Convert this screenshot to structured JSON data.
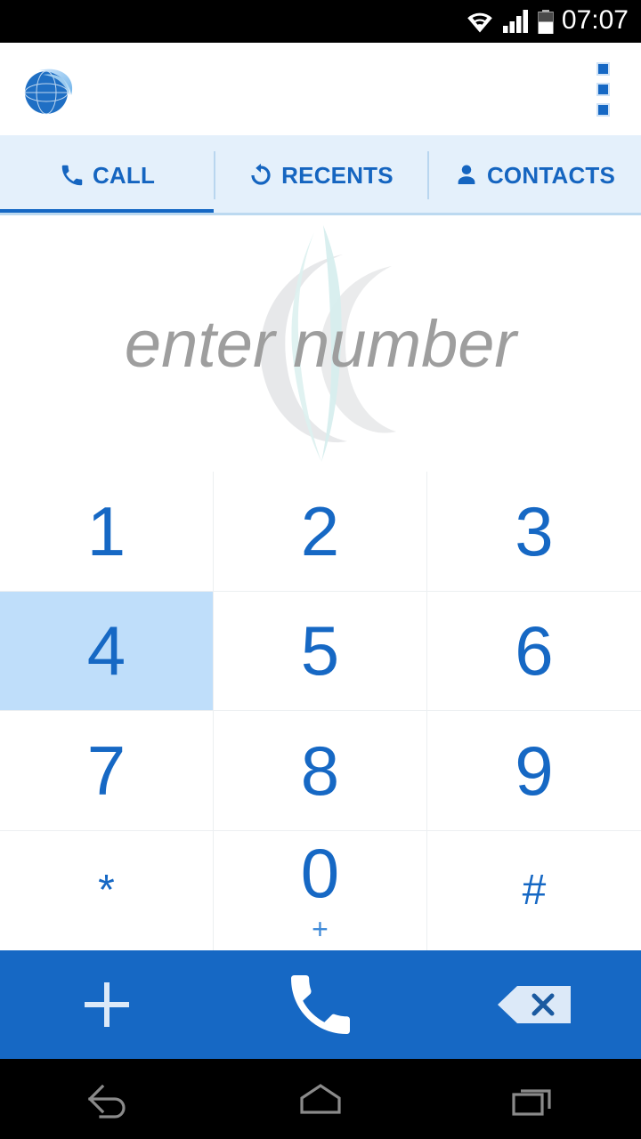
{
  "status_bar": {
    "time": "07:07",
    "icons": [
      "wifi-icon",
      "cellular-signal-icon",
      "battery-icon"
    ],
    "background_color": "#000000",
    "text_color": "#ffffff"
  },
  "app_bar": {
    "logo_name": "app-logo-globe",
    "overflow_menu_label": "",
    "background_color": "#ffffff"
  },
  "tabs": {
    "active_index": 0,
    "accent_color": "#1668c4",
    "background_color": "#e4f0fb",
    "items": [
      {
        "label": "CALL",
        "icon": "phone-icon",
        "active": true
      },
      {
        "label": "RECENTS",
        "icon": "history-icon",
        "active": false
      },
      {
        "label": "CONTACTS",
        "icon": "person-icon",
        "active": false
      }
    ]
  },
  "display": {
    "entry_value": "",
    "placeholder": "enter number",
    "placeholder_color": "#9e9e9e",
    "watermark_name": "crescent-watermark"
  },
  "keypad": {
    "pressed_key": "4",
    "digit_color": "#1668c4",
    "pressed_background": "#bfdefa",
    "keys": [
      {
        "digit": "1",
        "sub": "",
        "pressed": false,
        "small": false
      },
      {
        "digit": "2",
        "sub": "",
        "pressed": false,
        "small": false
      },
      {
        "digit": "3",
        "sub": "",
        "pressed": false,
        "small": false
      },
      {
        "digit": "4",
        "sub": "",
        "pressed": true,
        "small": false
      },
      {
        "digit": "5",
        "sub": "",
        "pressed": false,
        "small": false
      },
      {
        "digit": "6",
        "sub": "",
        "pressed": false,
        "small": false
      },
      {
        "digit": "7",
        "sub": "",
        "pressed": false,
        "small": false
      },
      {
        "digit": "8",
        "sub": "",
        "pressed": false,
        "small": false
      },
      {
        "digit": "9",
        "sub": "",
        "pressed": false,
        "small": false
      },
      {
        "digit": "*",
        "sub": "",
        "pressed": false,
        "small": true
      },
      {
        "digit": "0",
        "sub": "+",
        "pressed": false,
        "small": false
      },
      {
        "digit": "#",
        "sub": "",
        "pressed": false,
        "small": true
      }
    ]
  },
  "action_bar": {
    "background_color": "#1668c4",
    "buttons": [
      {
        "name": "add-contact-button",
        "icon": "plus-icon"
      },
      {
        "name": "call-button",
        "icon": "phone-handset-icon"
      },
      {
        "name": "backspace-button",
        "icon": "backspace-delete-icon"
      }
    ]
  },
  "nav_bar": {
    "background_color": "#000000",
    "buttons": [
      {
        "name": "nav-back-button",
        "icon": "back-arrow-icon"
      },
      {
        "name": "nav-home-button",
        "icon": "home-icon"
      },
      {
        "name": "nav-recents-button",
        "icon": "recents-overview-icon"
      }
    ]
  }
}
